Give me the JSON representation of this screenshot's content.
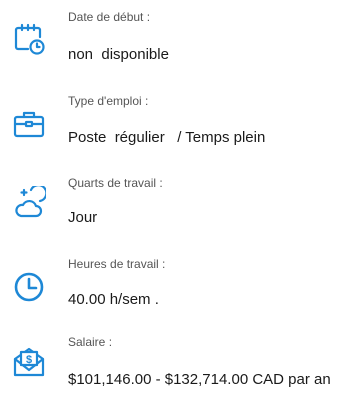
{
  "details": {
    "start_date": {
      "label": "Date de début :",
      "value": "non  disponible",
      "icon": "calendar-clock-icon"
    },
    "employment_type": {
      "label": "Type d'emploi :",
      "value": "Poste  régulier   / Temps plein",
      "icon": "briefcase-icon"
    },
    "shifts": {
      "label": "Quarts de travail :",
      "value": "Jour",
      "icon": "moon-cloud-icon"
    },
    "hours": {
      "label": "Heures de travail :",
      "value": "40.00 h/sem .",
      "icon": "clock-icon"
    },
    "salary": {
      "label": "Salaire :",
      "value": "$101,146.00 - $132,714.00 CAD par an",
      "icon": "salary-envelope-icon"
    }
  },
  "colors": {
    "icon_blue": "#1e88d6",
    "label_gray": "#555555",
    "value_dark": "#1a1a1a"
  }
}
